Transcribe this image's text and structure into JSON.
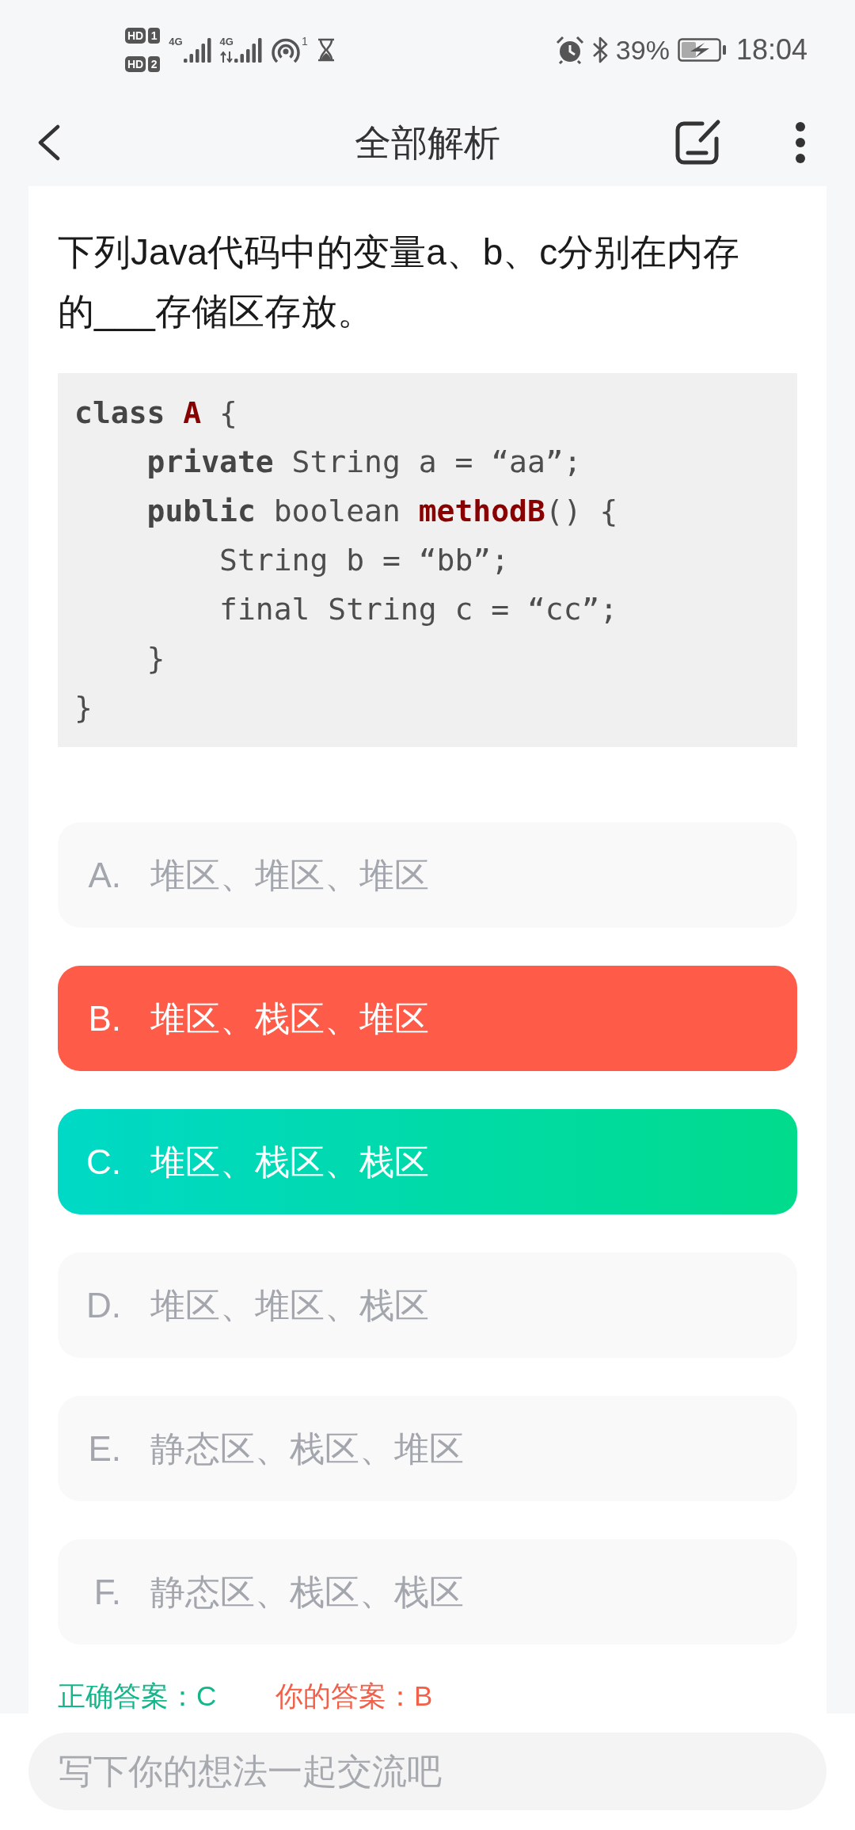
{
  "status_bar": {
    "sims": [
      {
        "label": "HD",
        "slot": "1"
      },
      {
        "label": "HD",
        "slot": "2"
      }
    ],
    "networks": [
      {
        "type": "4G",
        "data_active": false
      },
      {
        "type": "4G",
        "data_active": true
      }
    ],
    "hotspot_count": "1",
    "battery": "39%",
    "time": "18:04"
  },
  "header": {
    "title": "全部解析"
  },
  "question": {
    "text": "下列Java代码中的变量a、b、c分别在内存的___存储区存放。",
    "code": [
      {
        "tokens": [
          {
            "kind": "keyword",
            "text": "class "
          },
          {
            "kind": "title",
            "text": "A"
          },
          {
            "kind": "plain",
            "text": " {"
          }
        ],
        "children": [
          {
            "tokens": [
              {
                "kind": "keyword",
                "text": "private "
              },
              {
                "kind": "plain",
                "text": "String a = “aa”;"
              }
            ]
          },
          {
            "tokens": [
              {
                "kind": "keyword",
                "text": "public "
              },
              {
                "kind": "plain",
                "text": "boolean "
              },
              {
                "kind": "title",
                "text": "methodB"
              },
              {
                "kind": "plain",
                "text": "() {"
              }
            ],
            "children": [
              {
                "tokens": [
                  {
                    "kind": "plain",
                    "text": "String b = “bb”;"
                  }
                ]
              },
              {
                "tokens": [
                  {
                    "kind": "plain",
                    "text": "final String c = “cc”;"
                  }
                ]
              }
            ]
          },
          {
            "tokens": [
              {
                "kind": "plain",
                "text": "}"
              }
            ]
          }
        ]
      },
      {
        "tokens": [
          {
            "kind": "plain",
            "text": "}"
          }
        ]
      }
    ]
  },
  "options": [
    {
      "letter": "A.",
      "text": "堆区、堆区、堆区",
      "selected": false,
      "correct": false
    },
    {
      "letter": "B.",
      "text": "堆区、栈区、堆区",
      "selected": true,
      "correct": false
    },
    {
      "letter": "C.",
      "text": "堆区、栈区、栈区",
      "selected": false,
      "correct": true
    },
    {
      "letter": "D.",
      "text": "堆区、堆区、栈区",
      "selected": false,
      "correct": false
    },
    {
      "letter": "E.",
      "text": "静态区、栈区、堆区",
      "selected": false,
      "correct": false
    },
    {
      "letter": "F.",
      "text": "静态区、栈区、栈区",
      "selected": false,
      "correct": false
    }
  ],
  "result": {
    "correct_answer": "正确答案：C",
    "your_answer": "你的答案：B"
  },
  "comment": {
    "placeholder": "写下你的想法一起交流吧"
  }
}
